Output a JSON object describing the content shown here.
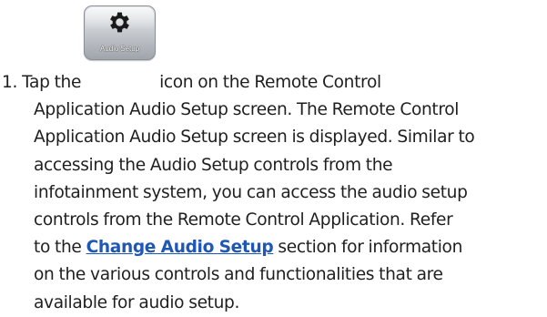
{
  "step": {
    "number": "1.",
    "text_before_icon": "Tap the",
    "icon": {
      "name": "gear-icon",
      "caption": "Audio Setup"
    },
    "line1_after_icon": "icon on the Remote Control",
    "line2": "Application Audio Setup screen. The Remote Control",
    "line3": "Application Audio Setup screen is displayed. Similar to",
    "line4": "accessing the Audio Setup controls from the",
    "line5": "infotainment system, you can access the audio setup",
    "line6": "controls from the Remote Control Application. Refer",
    "line7_before_link": "to the",
    "link_text": "Change Audio Setup",
    "line7_after_link": " section for information",
    "line8": "on the various controls and functionalities that are",
    "line9": "available for audio setup."
  },
  "colors": {
    "link": "#1f57b5",
    "text": "#1f1f1f"
  }
}
